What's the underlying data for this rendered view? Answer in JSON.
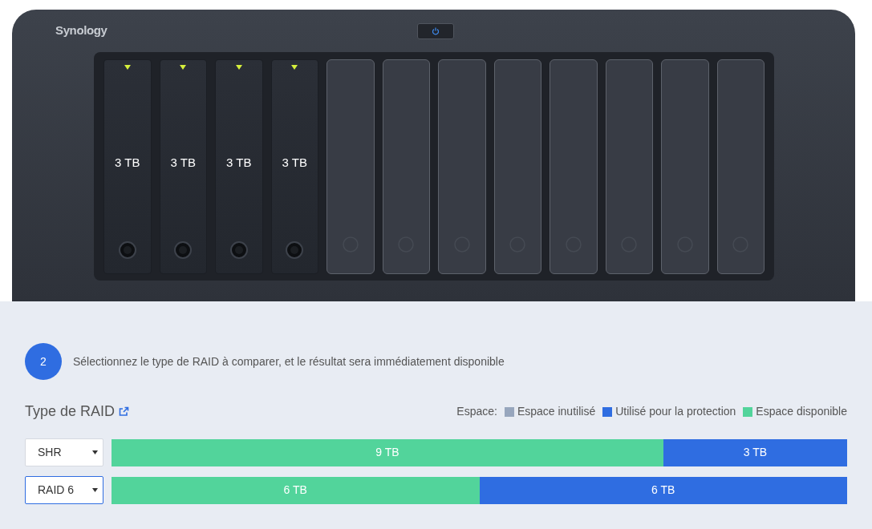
{
  "device": {
    "brand": "Synology",
    "bays": [
      {
        "kind": "disk",
        "capacity": "3 TB"
      },
      {
        "kind": "disk",
        "capacity": "3 TB"
      },
      {
        "kind": "disk",
        "capacity": "3 TB"
      },
      {
        "kind": "disk",
        "capacity": "3 TB"
      },
      {
        "kind": "empty"
      },
      {
        "kind": "empty"
      },
      {
        "kind": "empty"
      },
      {
        "kind": "empty"
      },
      {
        "kind": "empty"
      },
      {
        "kind": "empty"
      },
      {
        "kind": "empty"
      },
      {
        "kind": "empty"
      }
    ]
  },
  "step": {
    "number": "2",
    "text": "Sélectionnez le type de RAID à comparer, et le résultat sera immédiatement disponible"
  },
  "raid_type_label": "Type de RAID",
  "legend": {
    "label": "Espace:",
    "items": [
      {
        "label": "Espace inutilisé",
        "color": "#97a6bd"
      },
      {
        "label": "Utilisé pour la protection",
        "color": "#2f6de1"
      },
      {
        "label": "Espace disponible",
        "color": "#52d49b"
      }
    ]
  },
  "rows": [
    {
      "select": {
        "value": "SHR",
        "focused": false
      },
      "segments": [
        {
          "label": "9 TB",
          "color": "#52d49b",
          "level": 0.75
        },
        {
          "label": "3 TB",
          "color": "#2f6de1",
          "level": 0.25
        }
      ]
    },
    {
      "select": {
        "value": "RAID 6",
        "focused": true
      },
      "segments": [
        {
          "label": "6 TB",
          "color": "#52d49b",
          "level": 0.5
        },
        {
          "label": "6 TB",
          "color": "#2f6de1",
          "level": 0.5
        }
      ]
    }
  ]
}
